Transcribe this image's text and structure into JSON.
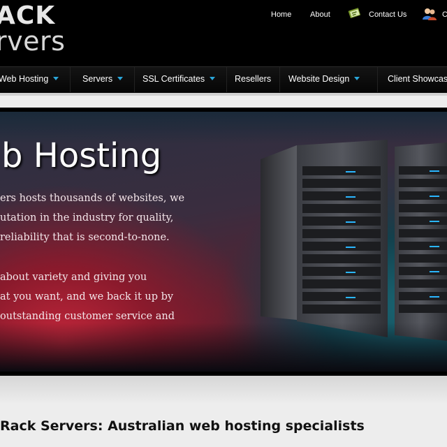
{
  "header": {
    "logo_line1": "ACK",
    "logo_line2": "rvers",
    "top_links": [
      "Home",
      "About",
      "Contact Us"
    ],
    "top_link_cut": "C"
  },
  "nav": {
    "items": [
      {
        "label": "Web Hosting",
        "has_dropdown": true
      },
      {
        "label": "Servers",
        "has_dropdown": true
      },
      {
        "label": "SSL Certificates",
        "has_dropdown": true
      },
      {
        "label": "Resellers",
        "has_dropdown": false
      },
      {
        "label": "Website Design",
        "has_dropdown": true
      },
      {
        "label": "Client Showcas",
        "has_dropdown": false
      }
    ],
    "caret_color": "#2aa6d9"
  },
  "banner": {
    "title": "b Hosting",
    "para1": [
      "ers hosts thousands of websites, we",
      "utation in the industry for quality,",
      " reliability that is second-to-none."
    ],
    "para2": [
      " about variety and giving you",
      "at you want, and we back it up by",
      "outstanding customer service and"
    ]
  },
  "tagline": "Rack Servers: Australian web hosting specialists",
  "icons": [
    "contact-card-icon",
    "users-icon",
    "dropdown-caret-icon"
  ]
}
